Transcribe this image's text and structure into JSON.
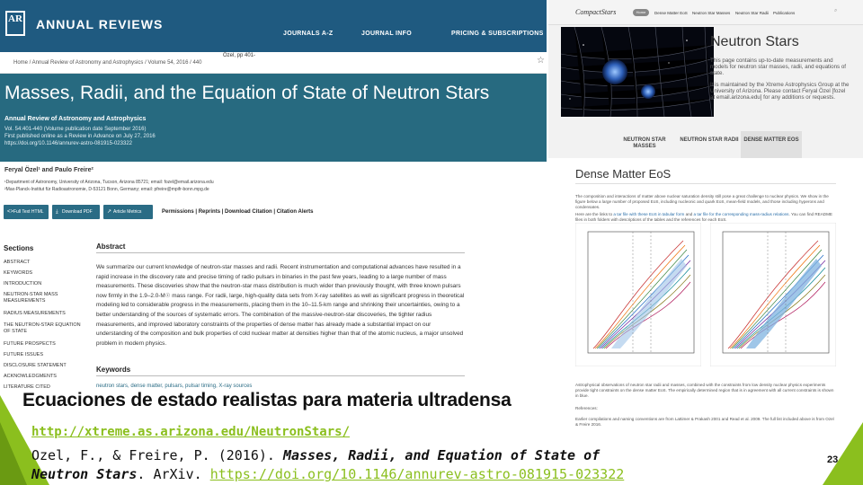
{
  "annual_reviews": {
    "brand": "ANNUAL REVIEWS",
    "logo_letters": "AR",
    "nav": [
      "JOURNALS A-Z",
      "JOURNAL INFO",
      "PRICING & SUBSCRIPTIONS"
    ],
    "breadcrumb": "Home  /  Annual Review of Astronomy and Astrophysics  /  Volume 54, 2016  /  440",
    "citation_short": "Özel, pp 401-",
    "article_title": "Masses, Radii, and the Equation of State of Neutron Stars",
    "journal": "Annual Review of Astronomy and Astrophysics",
    "meta": [
      "Vol. 54:401-440 (Volume publication date September 2016)",
      "First published online as a Review in Advance on July 27, 2016",
      "https://doi.org/10.1146/annurev-astro-081915-023322"
    ],
    "authors": "Feryal Özel¹ and Paulo Freire²",
    "affiliations": [
      "¹Department of Astronomy, University of Arizona, Tucson, Arizona 85721; email: fozel@email.arizona.edu",
      "²Max-Planck-Institut für Radioastronomie, D-53121 Bonn, Germany; email: pfreire@mpifr-bonn.mpg.de"
    ],
    "buttons": [
      "Full Text HTML",
      "Download PDF",
      "Article Metrics"
    ],
    "tools": "Permissions  |  Reprints  |  Download Citation  |  Citation Alerts",
    "sections_title": "Sections",
    "sections": [
      "ABSTRACT",
      "KEYWORDS",
      "INTRODUCTION",
      "NEUTRON-STAR MASS MEASUREMENTS",
      "RADIUS MEASUREMENTS",
      "THE NEUTRON-STAR EQUATION OF STATE",
      "FUTURE PROSPECTS",
      "FUTURE ISSUES",
      "DISCLOSURE STATEMENT",
      "ACKNOWLEDGMENTS",
      "LITERATURE CITED"
    ],
    "abstract_title": "Abstract",
    "abstract": "We summarize our current knowledge of neutron-star masses and radii. Recent instrumentation and computational advances have resulted in a rapid increase in the discovery rate and precise timing of radio pulsars in binaries in the past few years, leading to a large number of mass measurements. These discoveries show that the neutron-star mass distribution is much wider than previously thought, with three known pulsars now firmly in the 1.9–2.0-M☉ mass range. For radii, large, high-quality data sets from X-ray satellites as well as significant progress in theoretical modeling led to considerable progress in the measurements, placing them in the 10–11.5-km range and shrinking their uncertainties, owing to a better understanding of the sources of systematic errors. The combination of the massive-neutron-star discoveries, the tighter radius measurements, and improved laboratory constraints of the properties of dense matter has already made a substantial impact on our understanding of the composition and bulk properties of cold nuclear matter at densities higher than that of the atomic nucleus, a major unsolved problem in modern physics.",
    "keywords_title": "Keywords",
    "keywords": "neutron stars, dense matter, pulsars, pulsar timing, X-ray sources"
  },
  "compact_stars": {
    "logo": "CompactStars",
    "home": "Home",
    "nav": [
      "Dense Matter EoS",
      "Neutron Star Masses",
      "Neutron Star Radii",
      "Publications"
    ],
    "search_icon": "search-icon",
    "page_title": "Neutron Stars",
    "intro": "This page contains up-to-date measurements and models for neutron star masses, radii, and equations of state.",
    "maintainer": "It is maintained by the Xtreme Astrophysics Group at the University of Arizona. Please contact Feryal Özel [fozel at email.arizona.edu] for any additions or requests.",
    "tabs": [
      "NEUTRON STAR MASSES",
      "NEUTRON STAR RADII",
      "DENSE MATTER EOS"
    ],
    "section_title": "Dense Matter EoS",
    "para1": "The composition and interactions of matter above nuclear saturation density still pose a great challenge to nuclear physics. We show in the figure below a large number of proposed EoS, including nucleonic and quark EoS, mean-field models, and those including hyperons and condensates.",
    "para2_pre": "Here are the links to ",
    "para2_link1": "a tar file with these EoS in tabular form",
    "para2_mid": " and ",
    "para2_link2": "a tar file for the corresponding mass-radius relations",
    "para2_post": ". You can find README files in both folders with descriptions of the tables and the references for each EoS.",
    "caption": "Astrophysical observations of neutron star radii and masses, combined with the constraints from low density nuclear physics experiments provide tight constraints on the dense matter EoS. The empirically determined region that is in agreement with all current constraints is shown in blue.",
    "references_title": "References:",
    "references": "Earlier compilations and naming conventions are from Lattimer & Prakash 2001 and Read et al. 2009. The full list included above is from Ozel & Freire 2016."
  },
  "slide": {
    "title": "Ecuaciones de estado realistas para materia ultradensa",
    "url": "http://xtreme.as.arizona.edu/NeutronStars/",
    "cite_authors": "Ozel, F., & Freire, P. (2016). ",
    "cite_title_1": "Masses, Radii, and Equation of State of",
    "cite_title_2": "Neutron Stars",
    "cite_source": ". ArXiv. ",
    "cite_doi": "https://doi.org/10.1146/annurev-astro-081915-023322",
    "page_number": "23",
    "accent_color": "#8bbf1e"
  }
}
